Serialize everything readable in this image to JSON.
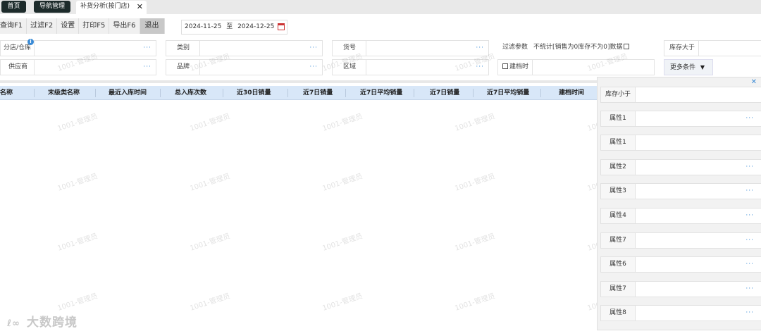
{
  "tabs": [
    {
      "label": "首页"
    },
    {
      "label": "导航管理"
    },
    {
      "label": "补货分析(按门店)",
      "close": "✕"
    }
  ],
  "toolbar": {
    "query": "查询F1",
    "filter": "过滤F2",
    "settings": "设置",
    "print": "打印F5",
    "export": "导出F6",
    "exit": "退出"
  },
  "date": {
    "from": "2024-11-25",
    "sep": "至",
    "to": "2024-12-25"
  },
  "filters": {
    "store": "分店/仓库",
    "category": "类别",
    "item_no": "货号",
    "filter_params": "过滤参数",
    "no_stat_text": "不统计[销售为0库存不为0]数据",
    "stock_gt": "库存大于",
    "supplier": "供应商",
    "brand": "品牌",
    "region": "区域",
    "created_time": "建档时",
    "more_conditions": "更多条件"
  },
  "icons": {
    "dots": "···",
    "info": "i",
    "caret": "▼"
  },
  "table": {
    "headers": [
      "名称",
      "末级类名称",
      "最近入库时间",
      "总入库次数",
      "近30日销量",
      "近7日销量",
      "近7日平均销量",
      "近7日销量",
      "近7日平均销量",
      "建档时间"
    ]
  },
  "panel": {
    "close": "✕",
    "rows": [
      {
        "label": "库存小于",
        "dots": false
      },
      {
        "label": "属性1",
        "dots": true
      },
      {
        "label": "属性1",
        "dots": false
      },
      {
        "label": "属性2",
        "dots": true
      },
      {
        "label": "属性3",
        "dots": true
      },
      {
        "label": "属性4",
        "dots": true
      },
      {
        "label": "属性7",
        "dots": true
      },
      {
        "label": "属性6",
        "dots": true
      },
      {
        "label": "属性7",
        "dots": true
      },
      {
        "label": "属性8",
        "dots": true
      }
    ]
  },
  "watermark": "1001-管理员",
  "logo": "大数跨境",
  "colors": {
    "header_bg": "#d8e7f8",
    "accent": "#3a8bd6",
    "dark_tab": "#1d2b2b"
  }
}
